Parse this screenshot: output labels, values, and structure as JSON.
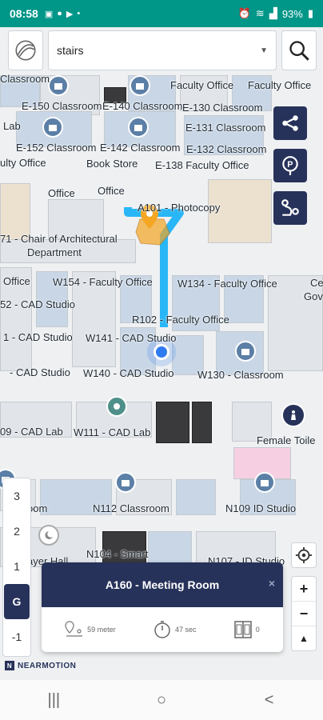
{
  "status": {
    "time": "08:58",
    "battery": "93%",
    "left_icons": [
      "image-icon",
      "message-icon",
      "youtube-icon",
      "dot-icon"
    ],
    "right_icons": [
      "alarm-icon",
      "mute-icon",
      "wifi-icon",
      "lte-icon",
      "signal-icon",
      "battery-icon"
    ]
  },
  "search": {
    "value": "stairs",
    "logo_icon": "compass-logo-icon",
    "search_icon": "search-icon"
  },
  "side_buttons": [
    "share-route-icon",
    "parking-icon",
    "route-plan-icon"
  ],
  "map": {
    "labels": [
      "Classroom",
      "Faculty Office",
      "Faculty Office",
      "E-150 Classroom",
      "E-140 Classroom",
      "E-130 Classroom",
      "Lab",
      "E-131 Classroom",
      "E-152 Classroom",
      "E-142 Classroom",
      "E-132 Classroom",
      "ulty Office",
      "Book Store",
      "E-138 Faculty Office",
      "Office",
      "Office",
      "A101 - Photocopy",
      "71 - Chair of Architectural",
      "Department",
      "Office",
      "W154 - Faculty Office",
      "W134 - Faculty Office",
      "Ce",
      "Gov",
      "52 - CAD Studio",
      "R102 - Faculty Office",
      "1 - CAD Studio",
      "W141 - CAD Studio",
      "- CAD Studio",
      "W140 - CAD Studio",
      "W130 - Classroom",
      "09 - CAD Lab",
      "W111 - CAD Lab",
      "Female Toile",
      "oom",
      "N112 Classroom",
      "N109 ID Studio",
      "ayer Hall",
      "N104 - Smart",
      "N107 - ID Studio"
    ]
  },
  "floors": [
    "3",
    "2",
    "1",
    "G",
    "-1"
  ],
  "active_floor": "G",
  "zoom": {
    "in": "+",
    "out": "−",
    "compass": "▲"
  },
  "card": {
    "title": "A160 - Meeting Room",
    "close": "×",
    "distance": "59 meter",
    "time": "47 sec",
    "elevator": "0"
  },
  "brand": {
    "name": "NEARMOTION",
    "mark": "N"
  },
  "nav": {
    "recent": "|||",
    "home": "○",
    "back": "<"
  },
  "colors": {
    "status_bar": "#009688",
    "primary": "#27325a",
    "route": "#29b6f6",
    "marker": "#f5a623"
  }
}
